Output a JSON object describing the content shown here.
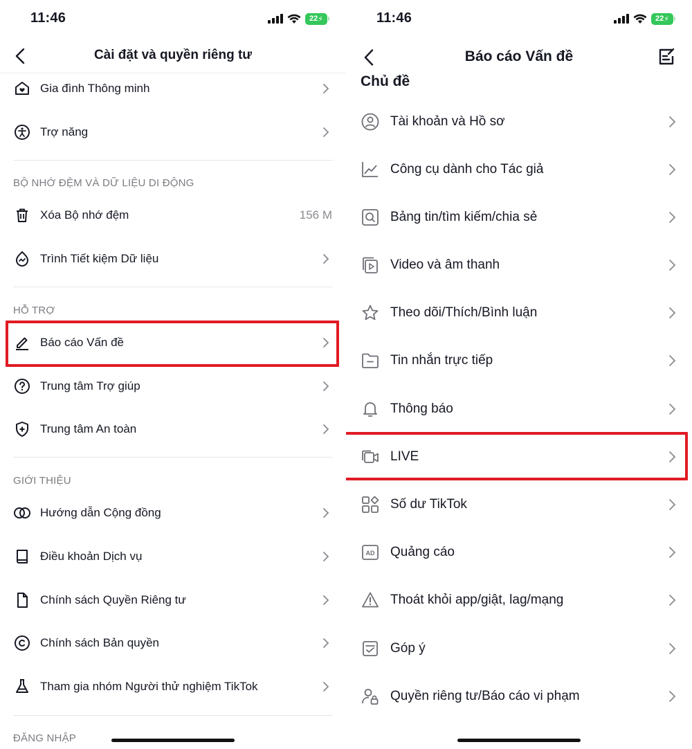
{
  "left": {
    "status_time": "11:46",
    "battery": "22",
    "title": "Cài đặt và quyền riêng tư",
    "rows_top": [
      {
        "label": "Gia đình Thông minh",
        "icon": "home-heart-icon"
      },
      {
        "label": "Trợ năng",
        "icon": "accessibility-icon"
      }
    ],
    "section_cache": "BỘ NHỚ ĐỆM VÀ DỮ LIỆU DI ĐỘNG",
    "rows_cache": [
      {
        "label": "Xóa Bộ nhớ đệm",
        "value": "156 M",
        "icon": "trash-icon"
      },
      {
        "label": "Trình Tiết kiệm Dữ liệu",
        "icon": "data-saver-icon"
      }
    ],
    "section_support": "HỖ TRỢ",
    "rows_support": [
      {
        "label": "Báo cáo Vấn đề",
        "icon": "pencil-icon"
      },
      {
        "label": "Trung tâm Trợ giúp",
        "icon": "help-circle-icon"
      },
      {
        "label": "Trung tâm An toàn",
        "icon": "shield-plus-icon"
      }
    ],
    "section_about": "GIỚI THIỆU",
    "rows_about": [
      {
        "label": "Hướng dẫn Cộng đồng",
        "icon": "rings-icon"
      },
      {
        "label": "Điều khoản Dịch vụ",
        "icon": "book-icon"
      },
      {
        "label": "Chính sách Quyền Riêng tư",
        "icon": "document-icon"
      },
      {
        "label": "Chính sách Bản quyền",
        "icon": "copyright-icon"
      },
      {
        "label": "Tham gia nhóm Người thử nghiệm TikTok",
        "icon": "flask-icon"
      }
    ],
    "section_login": "ĐĂNG NHẬP"
  },
  "right": {
    "status_time": "11:46",
    "battery": "22",
    "title": "Báo cáo Vấn đề",
    "topic_heading": "Chủ đề",
    "rows": [
      {
        "label": "Tài khoản và Hồ sơ",
        "icon": "user-circle-icon"
      },
      {
        "label": "Công cụ dành cho Tác giả",
        "icon": "line-chart-icon"
      },
      {
        "label": "Bảng tin/tìm kiếm/chia sẻ",
        "icon": "search-box-icon"
      },
      {
        "label": "Video và âm thanh",
        "icon": "video-stack-icon"
      },
      {
        "label": "Theo dõi/Thích/Bình luận",
        "icon": "star-icon"
      },
      {
        "label": "Tin nhắn trực tiếp",
        "icon": "folder-icon"
      },
      {
        "label": "Thông báo",
        "icon": "bell-icon"
      },
      {
        "label": "LIVE",
        "icon": "live-camera-icon"
      },
      {
        "label": "Số dư TikTok",
        "icon": "widgets-icon"
      },
      {
        "label": "Quảng cáo",
        "icon": "ad-icon"
      },
      {
        "label": "Thoát khỏi app/giật, lag/mạng",
        "icon": "warning-icon"
      },
      {
        "label": "Góp ý",
        "icon": "feedback-icon"
      },
      {
        "label": "Quyền riêng tư/Báo cáo vi phạm",
        "icon": "user-lock-icon"
      }
    ]
  },
  "colors": {
    "highlight": "#e01b24",
    "battery": "#34c759",
    "text": "#161823",
    "muted": "#7b7c82"
  }
}
